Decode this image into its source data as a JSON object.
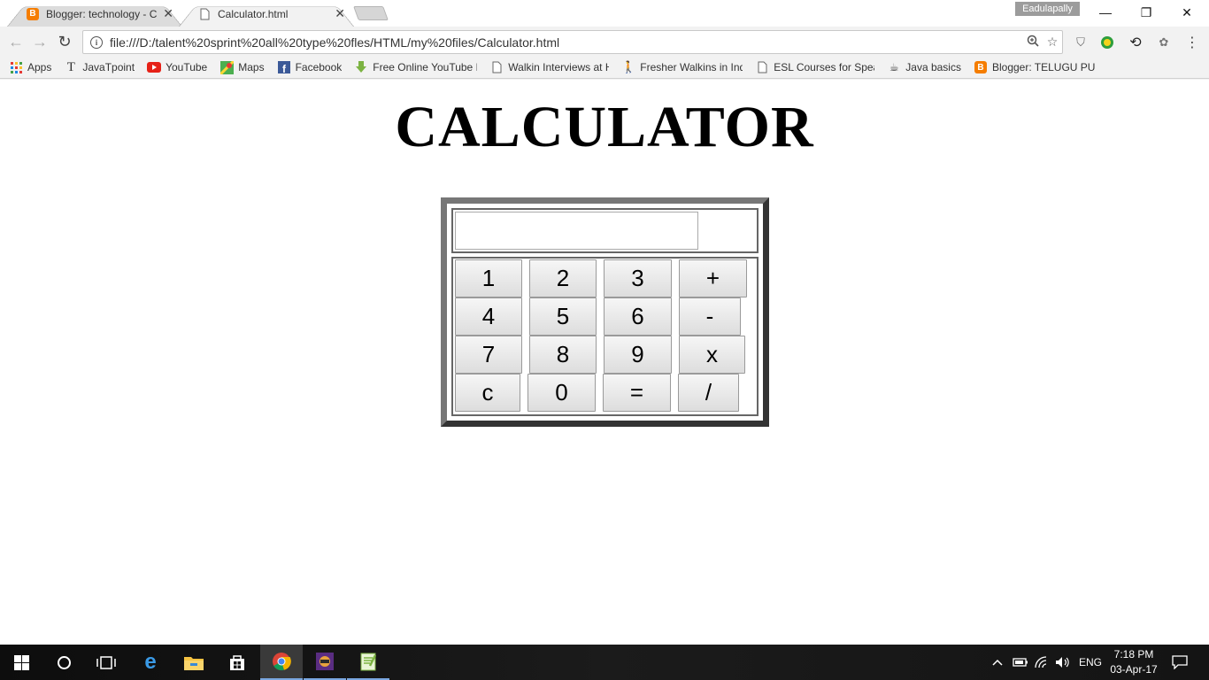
{
  "browser": {
    "tabs": [
      {
        "title": "Blogger: technology - Cr",
        "favicon": "blogger-icon"
      },
      {
        "title": "Calculator.html",
        "favicon": "page-icon"
      }
    ],
    "profile_name": "Eadulapally",
    "url": "file:///D:/talent%20sprint%20all%20type%20fles/HTML/my%20files/Calculator.html",
    "bookmarks": [
      {
        "label": "Apps",
        "icon": "apps-grid-icon"
      },
      {
        "label": "JavaTpoint",
        "icon": "javatpoint-icon"
      },
      {
        "label": "YouTube",
        "icon": "youtube-icon"
      },
      {
        "label": "Maps",
        "icon": "maps-icon"
      },
      {
        "label": "Facebook",
        "icon": "facebook-icon"
      },
      {
        "label": "Free Online YouTube D",
        "icon": "download-icon"
      },
      {
        "label": "Walkin Interviews at H",
        "icon": "page-icon"
      },
      {
        "label": "Fresher Walkins in Indi",
        "icon": "walker-icon"
      },
      {
        "label": "ESL Courses for Speak",
        "icon": "page-icon"
      },
      {
        "label": "Java basics",
        "icon": "java-icon"
      },
      {
        "label": "Blogger: TELUGU PUR",
        "icon": "blogger-icon"
      }
    ]
  },
  "calculator": {
    "title": "CALCULATOR",
    "display_value": "",
    "keys": [
      [
        "1",
        "2",
        "3",
        "+"
      ],
      [
        "4",
        "5",
        "6",
        "-"
      ],
      [
        "7",
        "8",
        "9",
        "x"
      ],
      [
        "c",
        "0",
        "=",
        "/"
      ]
    ]
  },
  "taskbar": {
    "language": "ENG",
    "time": "7:18 PM",
    "date": "03-Apr-17"
  },
  "colors": {
    "blogger_orange": "#f57d00",
    "youtube_red": "#e62117",
    "facebook_blue": "#3b5998",
    "calc_border_dark": "#333333",
    "calc_border_light": "#777777"
  }
}
